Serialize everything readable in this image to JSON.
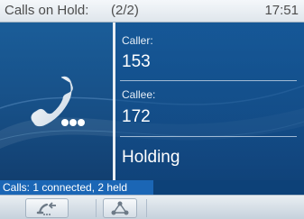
{
  "header": {
    "title": "Calls on Hold:",
    "count": "(2/2)",
    "time": "17:51"
  },
  "call": {
    "caller_label": "Caller:",
    "caller_value": "153",
    "callee_label": "Callee:",
    "callee_value": "172",
    "state": "Holding"
  },
  "status_bar": {
    "text": "Calls: 1 connected, 2 held"
  },
  "softkeys": [
    {
      "icon": "swap-call-icon"
    },
    {
      "icon": "conference-icon"
    }
  ],
  "colors": {
    "accent": "#1b66b5",
    "panel": "#174f86"
  }
}
